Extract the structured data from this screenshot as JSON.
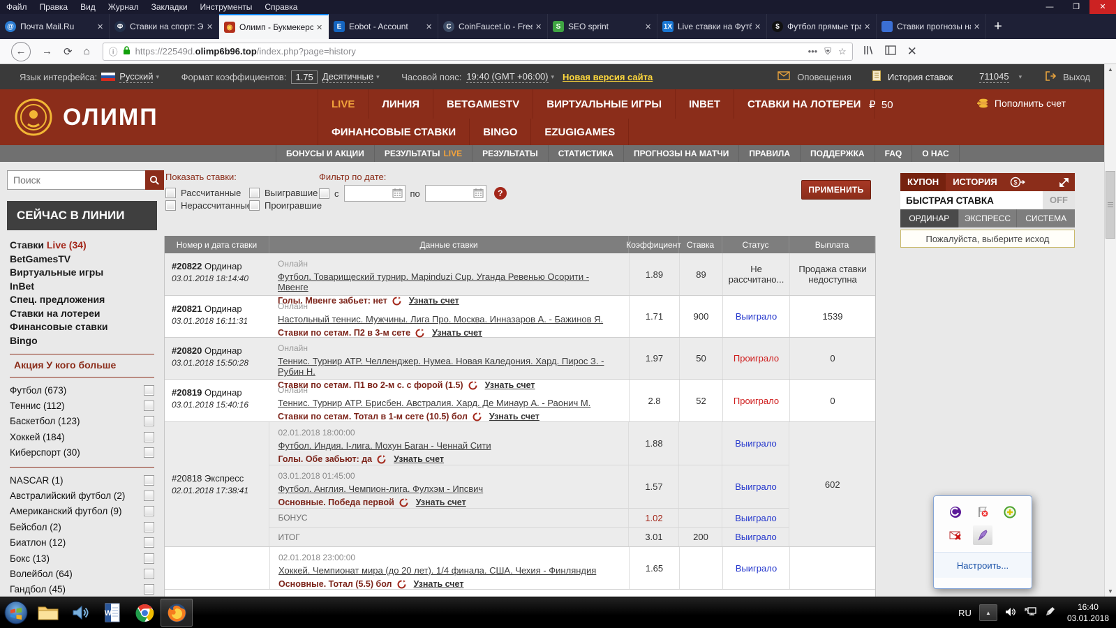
{
  "browser": {
    "menu": [
      "Файл",
      "Правка",
      "Вид",
      "Журнал",
      "Закладки",
      "Инструменты",
      "Справка"
    ],
    "tabs": [
      {
        "title": "Почта Mail.Ru"
      },
      {
        "title": "Ставки на спорт: Экс"
      },
      {
        "title": "Олимп - Букмекерск"
      },
      {
        "title": "Eobot - Account"
      },
      {
        "title": "CoinFaucet.io - Free Rippl"
      },
      {
        "title": "SEO sprint"
      },
      {
        "title": "Live ставки на Футбол"
      },
      {
        "title": "Футбол прямые тран"
      },
      {
        "title": "Ставки прогнозы на"
      }
    ],
    "url_prefix": "https://22549d.",
    "url_domain": "olimp6b96.top",
    "url_path": "/index.php?page=history"
  },
  "topbar": {
    "lang_label": "Язык интерфейса:",
    "lang_value": "Русский",
    "fmt_label": "Формат коэффициентов:",
    "fmt_value": "1.75",
    "fmt_type": "Десятичные",
    "tz_label": "Часовой пояс:",
    "tz_value": "19:40 (GMT +06:00)",
    "new_version": "Новая версия сайта",
    "notifications": "Оповещения",
    "bets_history": "История ставок",
    "account": "711045",
    "logout": "Выход"
  },
  "header": {
    "brand": "ОЛИМП",
    "nav1": [
      "LIVE",
      "ЛИНИЯ",
      "BETGAMESTV",
      "ВИРТУАЛЬНЫЕ ИГРЫ",
      "INBET",
      "СТАВКИ НА ЛОТЕРЕИ"
    ],
    "nav2": [
      "ФИНАНСОВЫЕ СТАВКИ",
      "BINGO",
      "EZUGIGAMES"
    ],
    "currency": "₽",
    "balance": "50",
    "deposit": "Пополнить счет",
    "accent_color": "#f2a33c",
    "brand_red": "#8b2d1a"
  },
  "subnav": {
    "i0": "БОНУСЫ И АКЦИИ",
    "results_pre": "РЕЗУЛЬТАТЫ",
    "results_accent": "LIVE",
    "i2": "РЕЗУЛЬТАТЫ",
    "i3": "СТАТИСТИКА",
    "i4": "ПРОГНОЗЫ НА МАТЧИ",
    "i5": "ПРАВИЛА",
    "i6": "ПОДДЕРЖКА",
    "i7": "FAQ",
    "i8": "О НАС"
  },
  "sidebar": {
    "search_placeholder": "Поиск",
    "now_in_line": "СЕЙЧАС В ЛИНИИ",
    "live_pre": "Ставки",
    "live_accent": "Live (34)",
    "links": [
      "BetGamesTV",
      "Виртуальные игры",
      "InBet",
      "Спец. предложения",
      "Ставки на лотереи",
      "Финансовые ставки",
      "Bingo"
    ],
    "promo": "Акция У кого больше",
    "sports_top": [
      "Футбол (673)",
      "Теннис (112)",
      "Баскетбол (123)",
      "Хоккей (184)",
      "Киберспорт (30)"
    ],
    "sports_bottom": [
      "NASCAR (1)",
      "Австралийский футбол (2)",
      "Американский футбол (9)",
      "Бейсбол (2)",
      "Биатлон (12)",
      "Бокс (13)",
      "Волейбол (64)",
      "Гандбол (45)"
    ]
  },
  "filters": {
    "show_label": "Показать ставки:",
    "cb1": "Рассчитанные",
    "cb2": "Нерассчитанные",
    "cb3": "Выигравшие",
    "cb4": "Проигравшие",
    "date_label": "Фильтр по дате:",
    "from": "с",
    "to": "по",
    "help": "?",
    "apply": "ПРИМЕНИТЬ"
  },
  "table": {
    "headers": [
      "Номер и дата ставки",
      "Данные ставки",
      "Коэффициент",
      "Ставка",
      "Статус",
      "Выплата"
    ],
    "online_label": "Онлайн",
    "score_link": "Узнать счет",
    "rows": [
      {
        "id": "#20822",
        "type": "Ординар",
        "date": "03.01.2018 18:14:40",
        "match": "Футбол. Товарищеский турнир. Mapinduzi Cup. Уганда Ревенью Осорити - Мвенге",
        "bet": "Голы. Мвенге забьет: нет",
        "coef": "1.89",
        "stake": "89",
        "status": "Не рассчитано...",
        "payout": "Продажа ставки недоступна"
      },
      {
        "id": "#20821",
        "type": "Ординар",
        "date": "03.01.2018 16:11:31",
        "match": "Настольный теннис. Мужчины. Лига Про. Москва. Инназаров А. - Бажинов Я.",
        "bet": "Ставки по сетам. П2 в 3-м сете",
        "coef": "1.71",
        "stake": "900",
        "status": "Выиграло",
        "payout": "1539"
      },
      {
        "id": "#20820",
        "type": "Ординар",
        "date": "03.01.2018 15:50:28",
        "match": "Теннис. Турнир ATP. Челленджер. Нумеа. Новая Каледония. Хард. Пирос З. - Рубин Н.",
        "bet": "Ставки по сетам. П1 во 2-м с. с форой (1.5)",
        "coef": "1.97",
        "stake": "50",
        "status": "Проиграло",
        "payout": "0"
      },
      {
        "id": "#20819",
        "type": "Ординар",
        "date": "03.01.2018 15:40:16",
        "match": "Теннис. Турнир ATP. Брисбен. Австралия. Хард. Де Минаур А. - Раонич М.",
        "bet": "Ставки по сетам. Тотал в 1-м сете (10.5) бол",
        "coef": "2.8",
        "stake": "52",
        "status": "Проиграло",
        "payout": "0"
      }
    ],
    "express": {
      "id": "#20818",
      "type": "Экспресс",
      "date": "02.01.2018 17:38:41",
      "payout": "602",
      "legs": [
        {
          "datetime": "02.01.2018 18:00:00",
          "match": "Футбол. Индия. I-лига. Мохун Баган - Ченнай Сити",
          "bet": "Голы. Обе забьют: да",
          "coef": "1.88",
          "status": "Выиграло"
        },
        {
          "datetime": "03.01.2018 01:45:00",
          "match": "Футбол. Англия. Чемпион-лига. Фулхэм - Ипсвич",
          "bet": "Основные. Победа первой",
          "coef": "1.57",
          "status": "Выиграло"
        }
      ],
      "bonus_label": "БОНУС",
      "bonus_coef": "1.02",
      "bonus_status": "Выиграло",
      "total_label": "ИТОГ",
      "total_coef": "3.01",
      "total_stake": "200",
      "total_status": "Выиграло"
    },
    "last_leg": {
      "datetime": "02.01.2018 23:00:00",
      "match": "Хоккей. Чемпионат мира (до 20 лет). 1/4 финала. США. Чехия - Финляндия",
      "bet": "Основные. Тотал (5.5) бол",
      "coef": "1.65",
      "status": "Выиграло"
    },
    "status_colors": {
      "win": "#2336cc",
      "lose": "#cf1d1d",
      "pending": "#333333"
    }
  },
  "coupon": {
    "tab_coupon": "КУПОН",
    "tab_history": "ИСТОРИЯ",
    "quick_bet": "БЫСТРАЯ СТАВКА",
    "state": "OFF",
    "tab_single": "ОРДИНАР",
    "tab_express": "ЭКСПРЕСС",
    "tab_system": "СИСТЕМА",
    "message": "Пожалуйста, выберите исход"
  },
  "tray_popup": {
    "customize": "Настроить..."
  },
  "taskbar": {
    "lang": "RU",
    "time": "16:40",
    "date": "03.01.2018"
  }
}
